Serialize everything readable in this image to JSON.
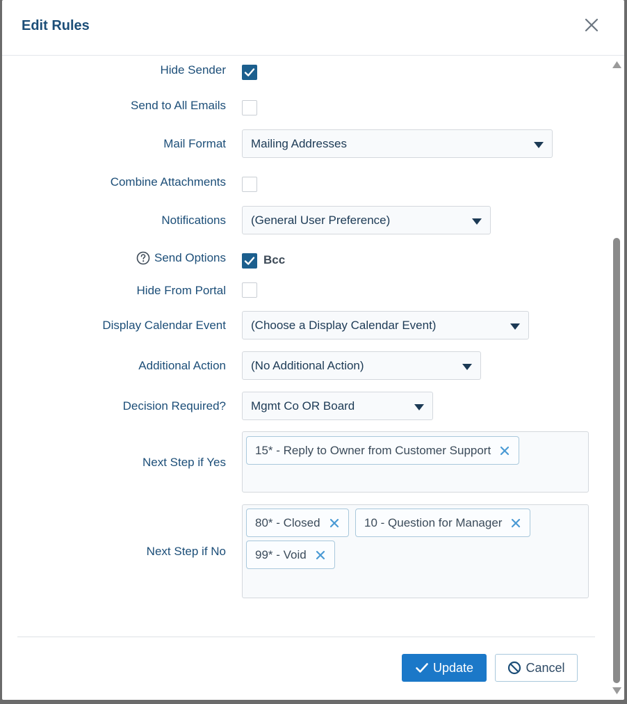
{
  "dialog": {
    "title": "Edit Rules",
    "close_icon": "close-icon"
  },
  "fields": {
    "hide_sender": {
      "label": "Hide Sender",
      "checked": true
    },
    "send_to_all_emails": {
      "label": "Send to All Emails",
      "checked": false
    },
    "mail_format": {
      "label": "Mail Format",
      "value": "Mailing Addresses"
    },
    "combine_attachments": {
      "label": "Combine Attachments",
      "checked": false
    },
    "notifications": {
      "label": "Notifications",
      "value": "(General User Preference)"
    },
    "send_options": {
      "label": "Send Options",
      "option_label": "Bcc",
      "checked": true,
      "help_icon": "question-circle-icon"
    },
    "hide_from_portal": {
      "label": "Hide From Portal",
      "checked": false
    },
    "display_calendar_event": {
      "label": "Display Calendar Event",
      "value": "(Choose a Display Calendar Event)"
    },
    "additional_action": {
      "label": "Additional Action",
      "value": "(No Additional Action)"
    },
    "decision_required": {
      "label": "Decision Required?",
      "value": "Mgmt Co OR Board"
    },
    "next_step_if_yes": {
      "label": "Next Step if Yes",
      "tags": [
        "15* - Reply to Owner from Customer Support"
      ]
    },
    "next_step_if_no": {
      "label": "Next Step if No",
      "tags": [
        "80* - Closed",
        "10 - Question for Manager",
        "99* - Void"
      ]
    }
  },
  "footer": {
    "update_label": "Update",
    "cancel_label": "Cancel"
  },
  "colors": {
    "accent": "#1b78c8",
    "label_text": "#1c4e78",
    "checkbox_checked": "#1c5f8e"
  }
}
